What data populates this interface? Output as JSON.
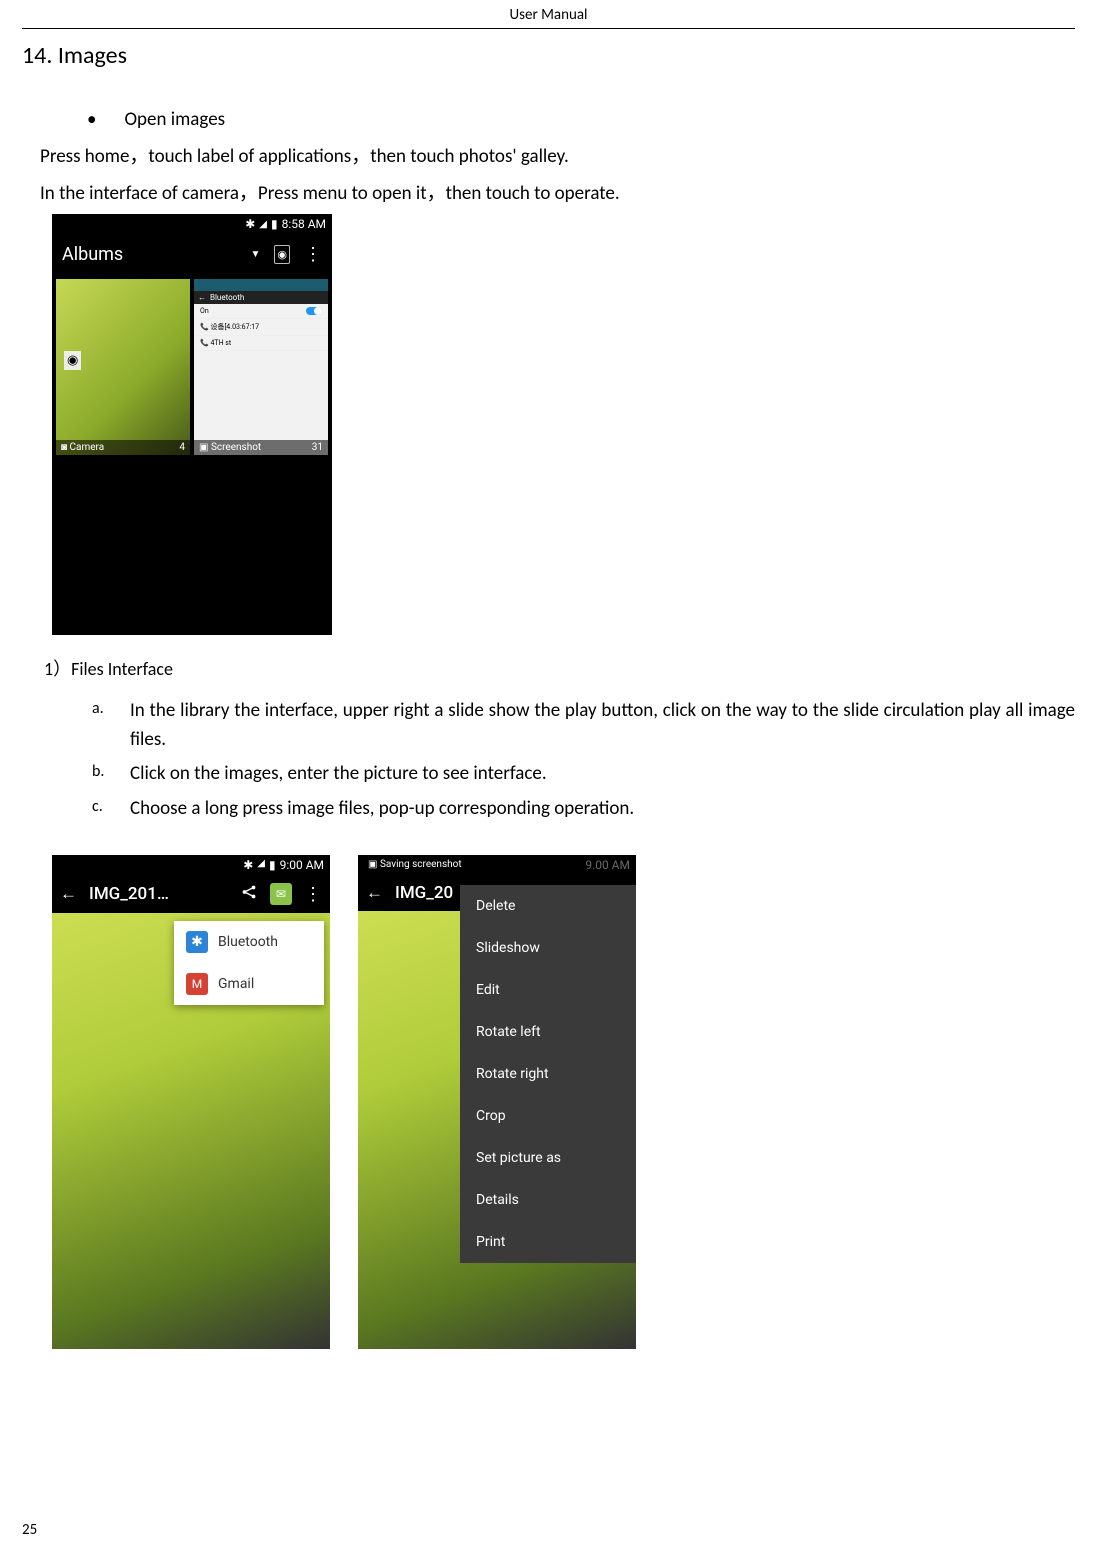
{
  "header": "User    Manual",
  "section_number_title": "14. Images",
  "bullet_open": "Open images",
  "para1": "Press home，touch label of applications，then touch photos' galley.",
  "para2": "In the interface of camera，Press menu to open it，then touch to operate.",
  "shot1": {
    "time": "8:58 AM",
    "title": "Albums",
    "album_camera": {
      "label": "Camera",
      "count": "4"
    },
    "album_screenshot": {
      "label": "Screenshot",
      "count": "31"
    },
    "screenshot_thumb": {
      "bar_label": "Bluetooth",
      "toggle_label": "On",
      "row1": "设备[4.03:67:17",
      "row2": "4TH st"
    }
  },
  "files_interface_heading": "1）Files Interface",
  "list": {
    "a": "In the library the interface, upper right a slide show the play button, click on the way to the slide circulation play all image files.",
    "b": "Click on the images, enter the picture to see interface.",
    "c": "Choose a long press image files, pop-up corresponding operation."
  },
  "shot2": {
    "time": "9:00 AM",
    "title": "IMG_201…",
    "dropdown": {
      "bluetooth": "Bluetooth",
      "gmail": "Gmail"
    }
  },
  "shot3": {
    "notif": "Saving screenshot",
    "title": "IMG_20",
    "menu": {
      "delete": "Delete",
      "slideshow": "Slideshow",
      "edit": "Edit",
      "rotate_left": "Rotate left",
      "rotate_right": "Rotate right",
      "crop": "Crop",
      "set_as": "Set picture as",
      "details": "Details",
      "print": "Print"
    }
  },
  "page_number": "25"
}
